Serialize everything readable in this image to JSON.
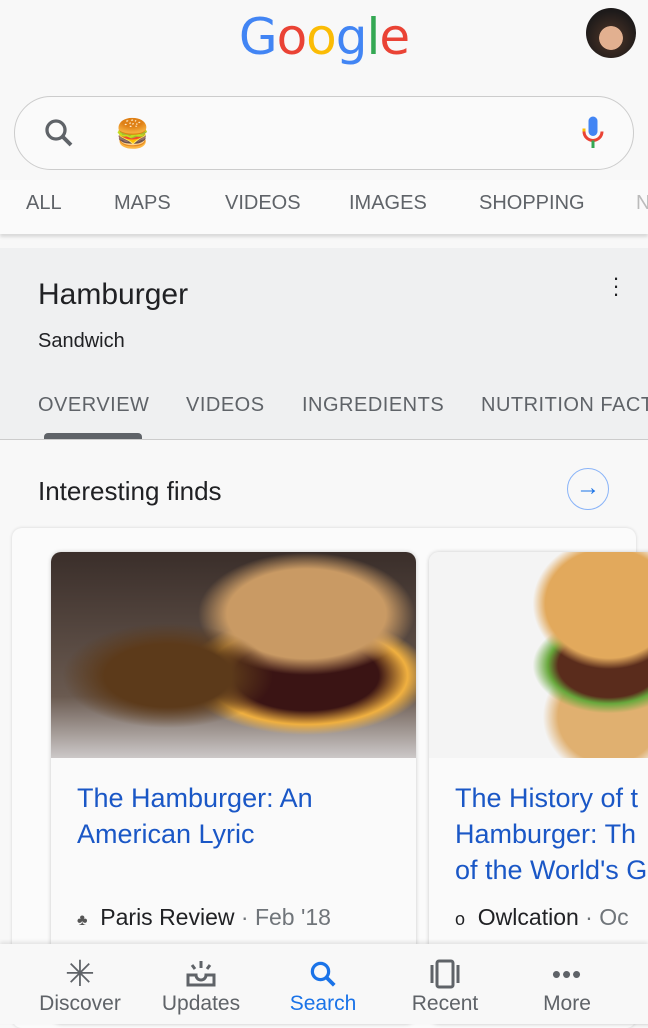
{
  "header": {
    "logo": "Google",
    "avatar": "user-avatar"
  },
  "search": {
    "query": "🍔",
    "icon": "search-icon",
    "mic": "mic-icon"
  },
  "tabs": [
    "ALL",
    "MAPS",
    "VIDEOS",
    "IMAGES",
    "SHOPPING",
    "N"
  ],
  "knowledge_panel": {
    "title": "Hamburger",
    "subtitle": "Sandwich",
    "tabs": [
      "OVERVIEW",
      "VIDEOS",
      "INGREDIENTS",
      "NUTRITION FACTS"
    ],
    "active_tab": "OVERVIEW"
  },
  "section": {
    "title": "Interesting finds"
  },
  "cards": [
    {
      "title_lines": [
        "The Hamburger: An",
        "American Lyric"
      ],
      "source": "Paris Review",
      "date": "· Feb '18"
    },
    {
      "title_lines": [
        "The History of t",
        "Hamburger: Th",
        "of the World's G"
      ],
      "source": "Owlcation",
      "date": "· Oc"
    }
  ],
  "bottom_nav": [
    {
      "label": "Discover",
      "icon": "asterisk-icon"
    },
    {
      "label": "Updates",
      "icon": "updates-tray-icon"
    },
    {
      "label": "Search",
      "icon": "search-icon",
      "active": true
    },
    {
      "label": "Recent",
      "icon": "recent-cards-icon"
    },
    {
      "label": "More",
      "icon": "more-dots-icon"
    }
  ],
  "colors": {
    "accent": "#1a73e8",
    "link": "#1a57c6"
  }
}
